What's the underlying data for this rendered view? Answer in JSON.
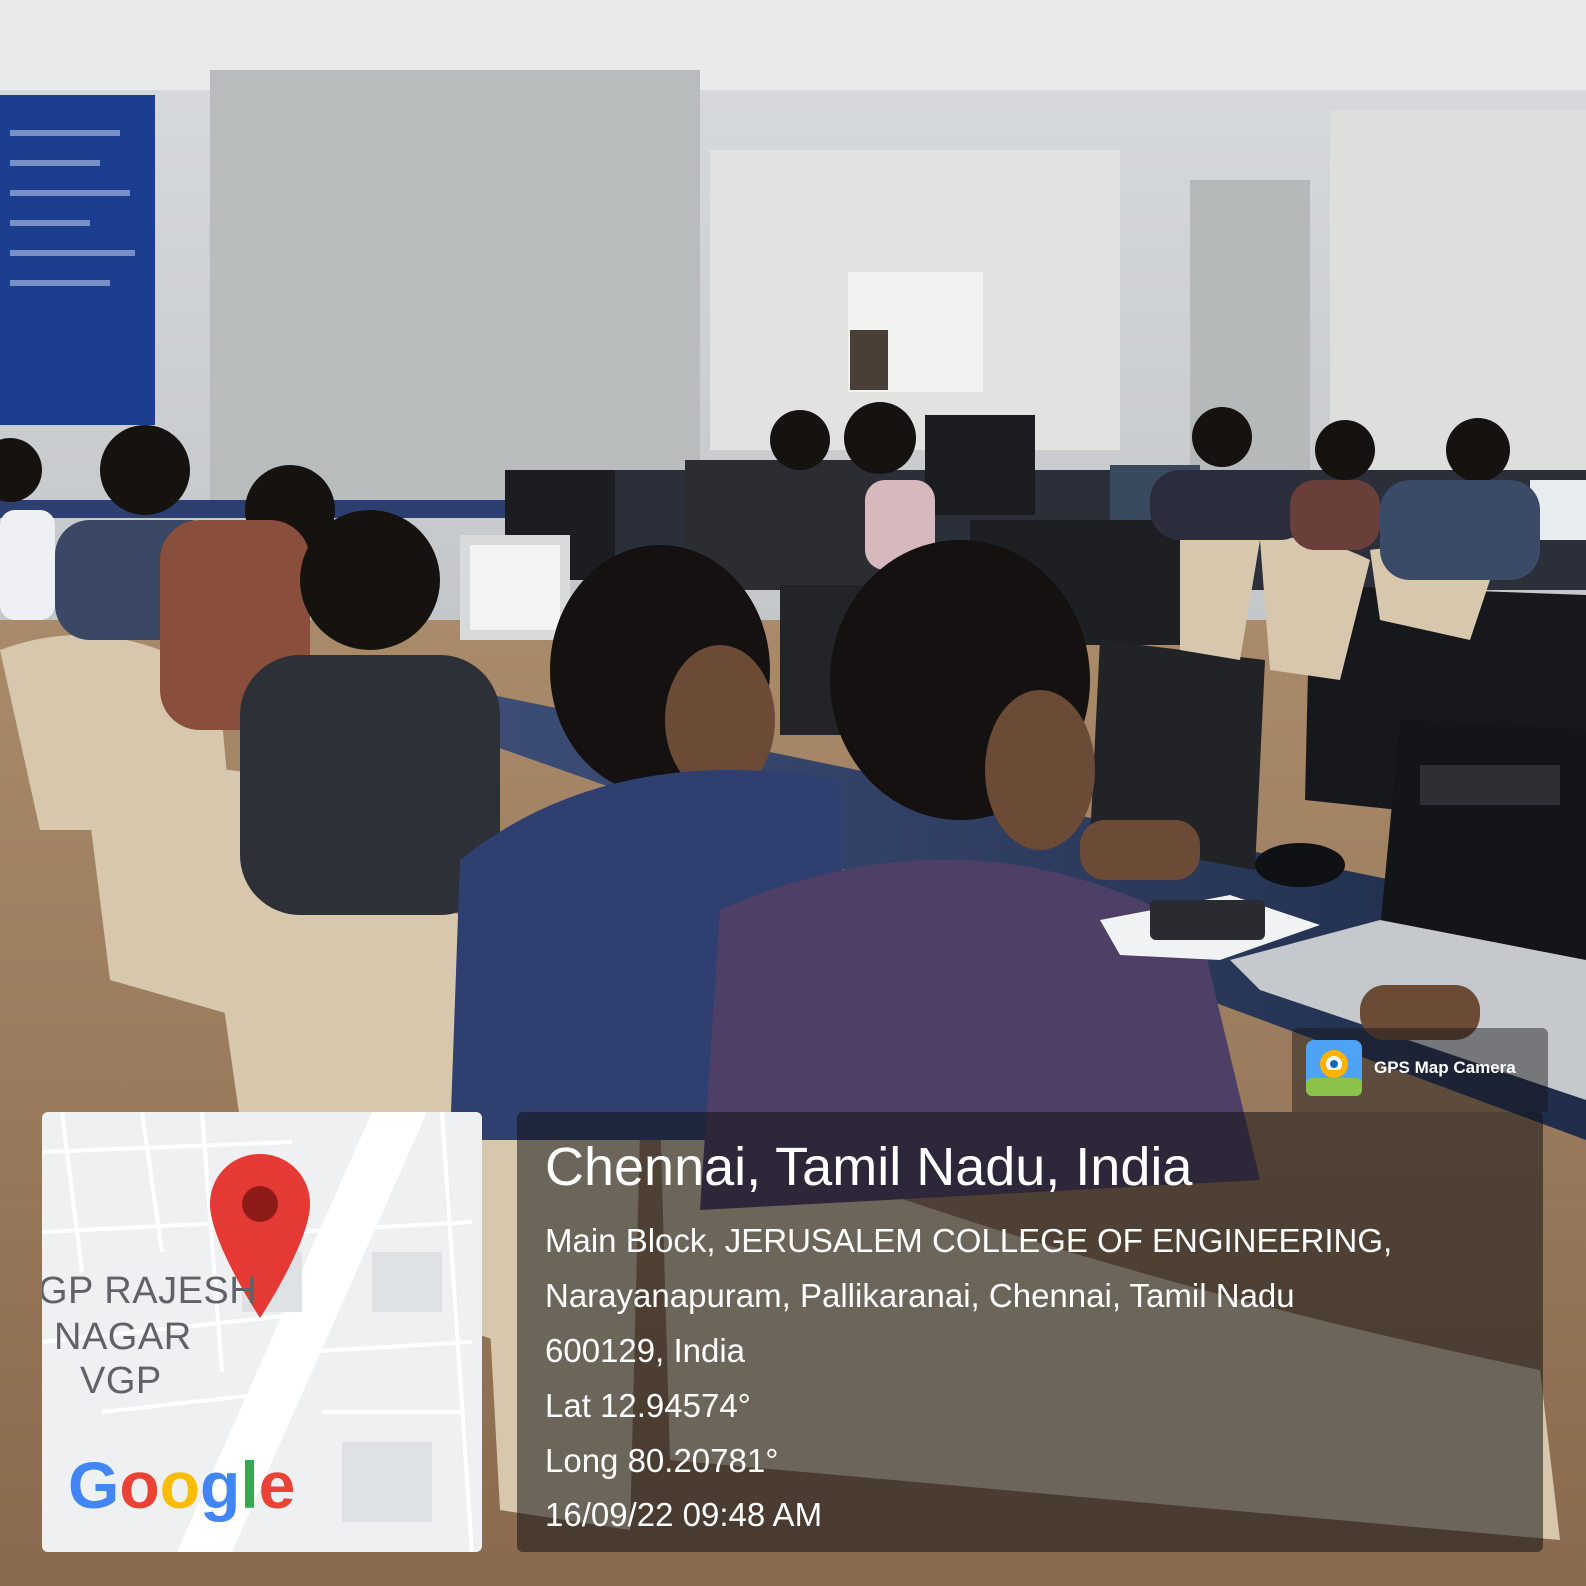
{
  "photo": {
    "scene": "computer lab with students seated at monitors"
  },
  "map": {
    "labels": [
      "GP RAJESH",
      "NAGAR",
      "VGP"
    ],
    "provider_logo": "Google",
    "marker_icon": "location-pin-icon",
    "marker_color": "#e53935"
  },
  "geotag": {
    "title": "Chennai, Tamil Nadu, India",
    "address_line1": "Main Block, JERUSALEM COLLEGE OF ENGINEERING,",
    "address_line2": "Narayanapuram, Pallikaranai, Chennai, Tamil Nadu",
    "address_line3": "600129, India",
    "latitude": "Lat 12.94574°",
    "longitude": "Long 80.20781°",
    "timestamp": "16/09/22 09:48 AM"
  },
  "badge": {
    "app_name": "GPS Map Camera",
    "icon": "gps-map-camera-icon"
  }
}
